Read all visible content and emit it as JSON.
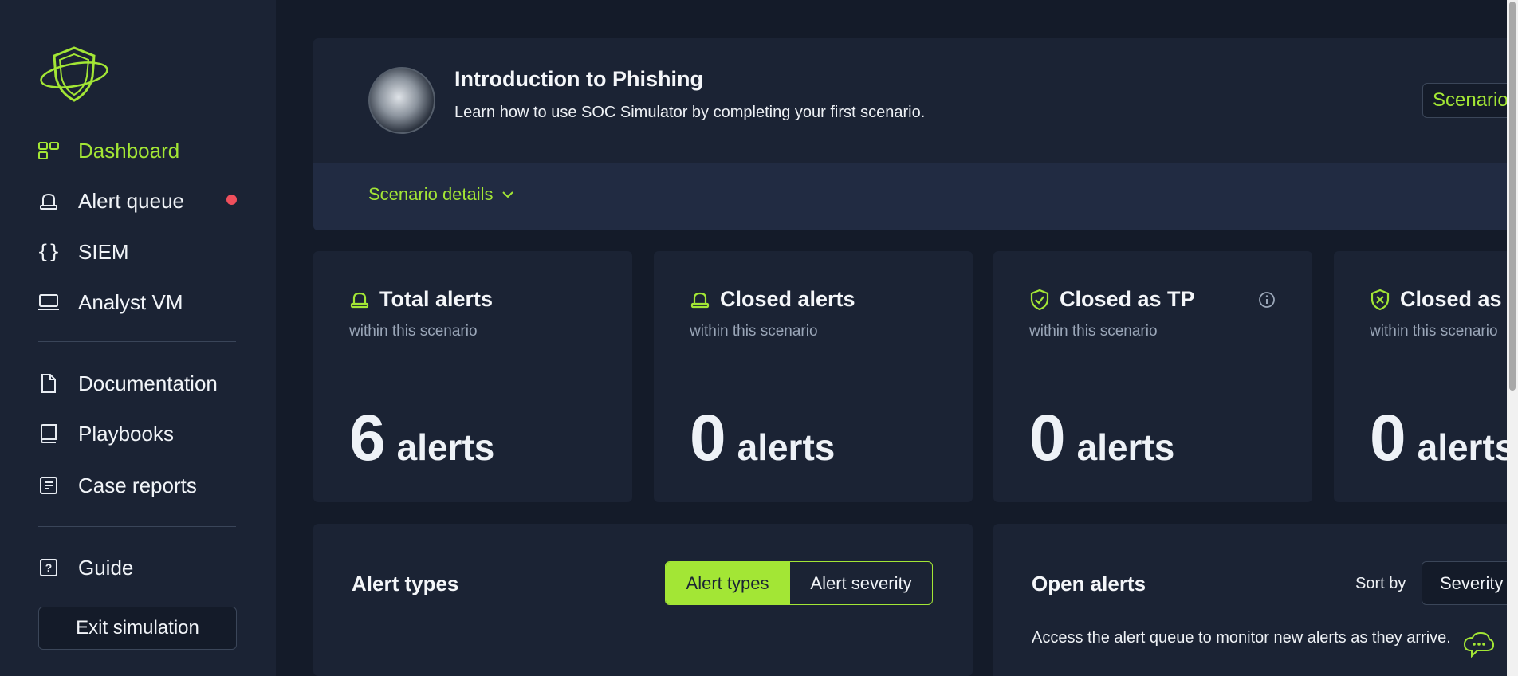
{
  "sidebar": {
    "nav": [
      {
        "label": "Dashboard",
        "icon": "dashboard-icon",
        "active": true
      },
      {
        "label": "Alert queue",
        "icon": "alert-siren-icon",
        "active": false
      },
      {
        "label": "SIEM",
        "icon": "braces-icon",
        "active": false
      },
      {
        "label": "Analyst VM",
        "icon": "monitor-icon",
        "active": false
      }
    ],
    "resources": [
      {
        "label": "Documentation",
        "icon": "document-icon"
      },
      {
        "label": "Playbooks",
        "icon": "book-icon"
      },
      {
        "label": "Case reports",
        "icon": "report-icon"
      }
    ],
    "guide": {
      "label": "Guide",
      "icon": "question-icon"
    },
    "exit_label": "Exit simulation"
  },
  "scenario": {
    "title": "Introduction to Phishing",
    "subtitle": "Learn how to use SOC Simulator by completing your first scenario.",
    "badge": "Scenario",
    "details_label": "Scenario details"
  },
  "stats": [
    {
      "title": "Total alerts",
      "sub": "within this scenario",
      "value": "6",
      "unit": "alerts",
      "icon": "siren-icon"
    },
    {
      "title": "Closed alerts",
      "sub": "within this scenario",
      "value": "0",
      "unit": "alerts",
      "icon": "siren-icon"
    },
    {
      "title": "Closed as TP",
      "sub": "within this scenario",
      "value": "0",
      "unit": "alerts",
      "icon": "shield-check-icon"
    },
    {
      "title": "Closed as F",
      "sub": "within this scenario",
      "value": "0",
      "unit": "alerts",
      "icon": "shield-x-icon"
    }
  ],
  "alert_types_panel": {
    "title": "Alert types",
    "toggle": [
      "Alert types",
      "Alert severity"
    ]
  },
  "open_alerts_panel": {
    "title": "Open alerts",
    "sort_label": "Sort by",
    "sort_value": "Severity",
    "description": "Access the alert queue to monitor new alerts as they arrive."
  },
  "colors": {
    "accent": "#a3e635",
    "background": "#141b29",
    "card": "#1b2334",
    "notification_dot": "#ef4f5c"
  }
}
